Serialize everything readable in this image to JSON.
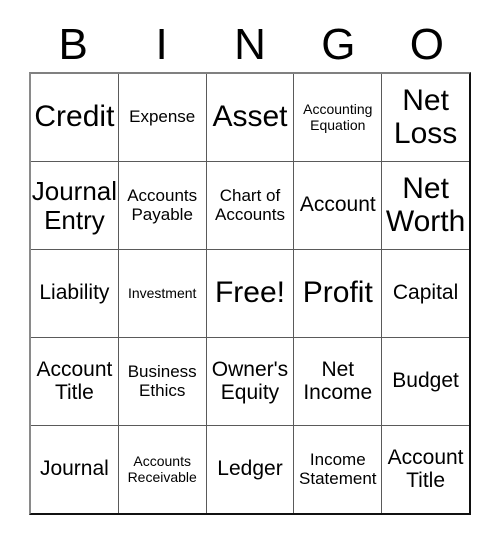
{
  "card": {
    "title": "BINGO",
    "header_letters": [
      "B",
      "I",
      "N",
      "G",
      "O"
    ],
    "free_space_label": "Free!",
    "colors": {
      "background": "#ffffff",
      "text": "#000000",
      "grid_line": "#5a5a5a",
      "grid_border": "#111111"
    },
    "rows": [
      [
        {
          "text": "Credit",
          "size": "fs-xl"
        },
        {
          "text": "Expense",
          "size": "fs-sm"
        },
        {
          "text": "Asset",
          "size": "fs-xl"
        },
        {
          "text": "Accounting\nEquation",
          "size": "fs-xs"
        },
        {
          "text": "Net\nLoss",
          "size": "fs-xl"
        }
      ],
      [
        {
          "text": "Journal\nEntry",
          "size": "fs-lg"
        },
        {
          "text": "Accounts\nPayable",
          "size": "fs-sm"
        },
        {
          "text": "Chart of\nAccounts",
          "size": "fs-sm"
        },
        {
          "text": "Account",
          "size": "fs-md"
        },
        {
          "text": "Net\nWorth",
          "size": "fs-xl"
        }
      ],
      [
        {
          "text": "Liability",
          "size": "fs-md"
        },
        {
          "text": "Investment",
          "size": "fs-xs"
        },
        {
          "text": "Free!",
          "size": "fs-xl"
        },
        {
          "text": "Profit",
          "size": "fs-xl"
        },
        {
          "text": "Capital",
          "size": "fs-md"
        }
      ],
      [
        {
          "text": "Account\nTitle",
          "size": "fs-md"
        },
        {
          "text": "Business\nEthics",
          "size": "fs-sm"
        },
        {
          "text": "Owner's\nEquity",
          "size": "fs-md"
        },
        {
          "text": "Net\nIncome",
          "size": "fs-md"
        },
        {
          "text": "Budget",
          "size": "fs-md"
        }
      ],
      [
        {
          "text": "Journal",
          "size": "fs-md"
        },
        {
          "text": "Accounts\nReceivable",
          "size": "fs-xs"
        },
        {
          "text": "Ledger",
          "size": "fs-md"
        },
        {
          "text": "Income\nStatement",
          "size": "fs-sm"
        },
        {
          "text": "Account\nTitle",
          "size": "fs-md"
        }
      ]
    ]
  }
}
